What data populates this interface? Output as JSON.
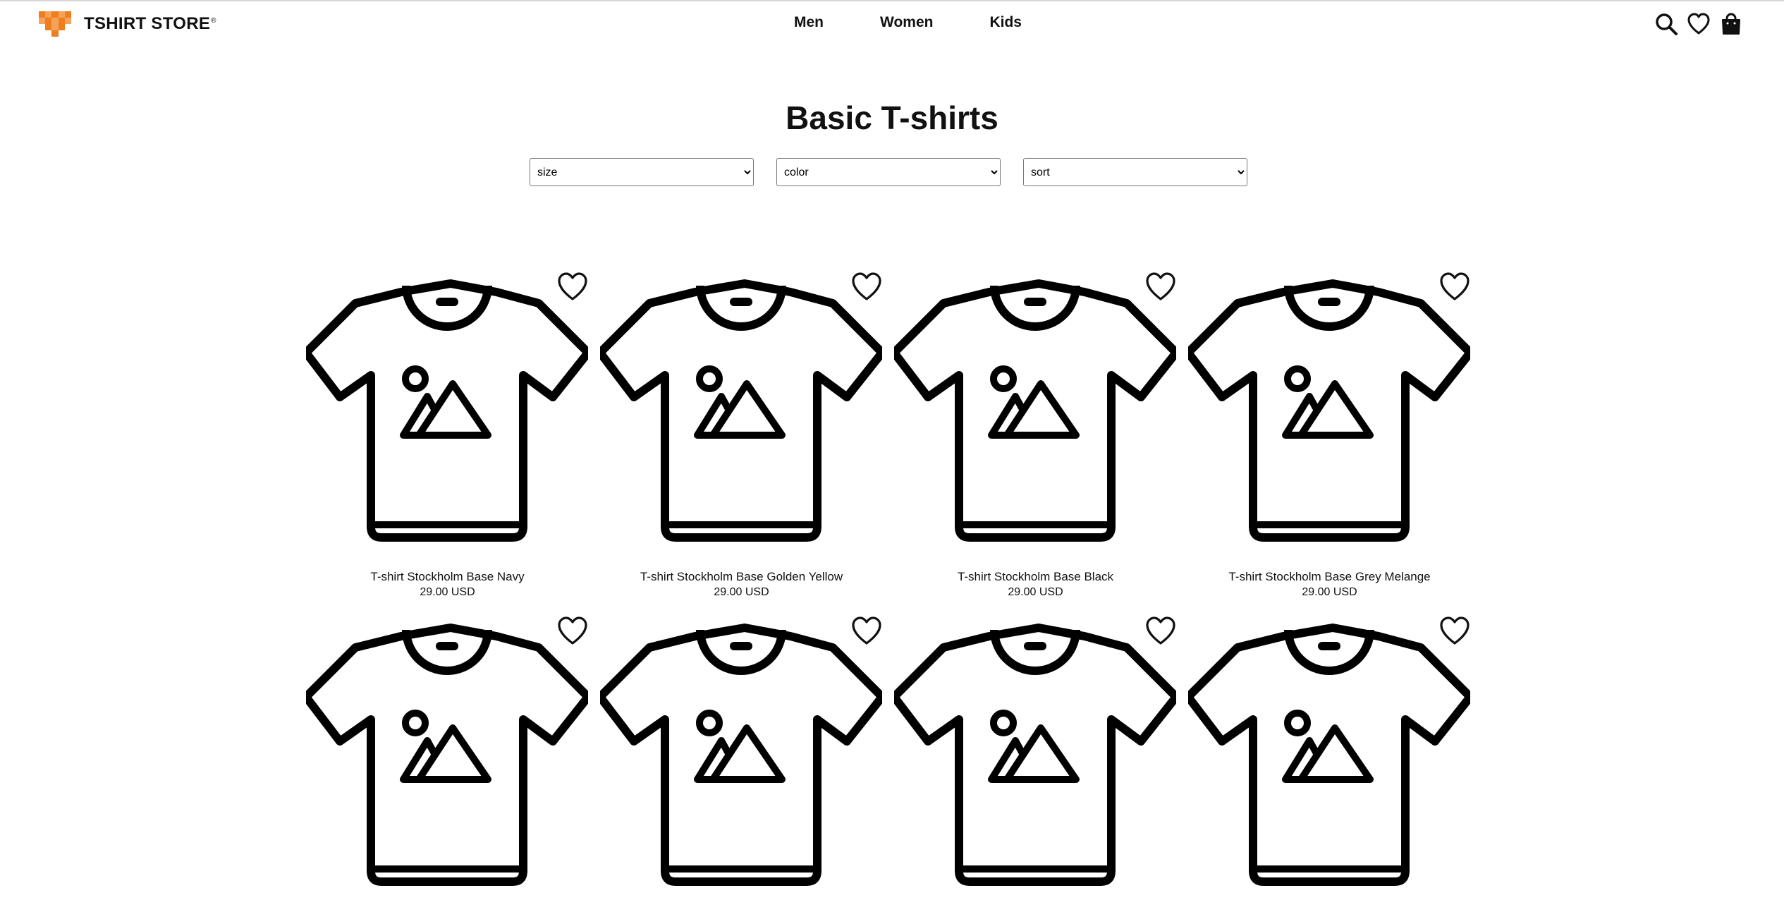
{
  "header": {
    "brand": "TSHIRT STORE",
    "trademark": "®",
    "nav": [
      "Men",
      "Women",
      "Kids"
    ],
    "icons": [
      "search-icon",
      "heart-icon",
      "shopping-bag-icon"
    ],
    "logo_colors": [
      "#f07d1e",
      "#f5a25a",
      "#fbd0a6"
    ]
  },
  "page": {
    "title": "Basic T-shirts"
  },
  "filters": {
    "size": "size",
    "color": "color",
    "sort": "sort"
  },
  "products": [
    {
      "name": "T-shirt Stockholm Base Navy",
      "price": "29.00 USD"
    },
    {
      "name": "T-shirt Stockholm Base Golden Yellow",
      "price": "29.00 USD"
    },
    {
      "name": "T-shirt Stockholm Base Black",
      "price": "29.00 USD"
    },
    {
      "name": "T-shirt Stockholm Base Grey Melange",
      "price": "29.00 USD"
    },
    {
      "name": "",
      "price": ""
    },
    {
      "name": "",
      "price": ""
    },
    {
      "name": "",
      "price": ""
    },
    {
      "name": "",
      "price": ""
    }
  ]
}
